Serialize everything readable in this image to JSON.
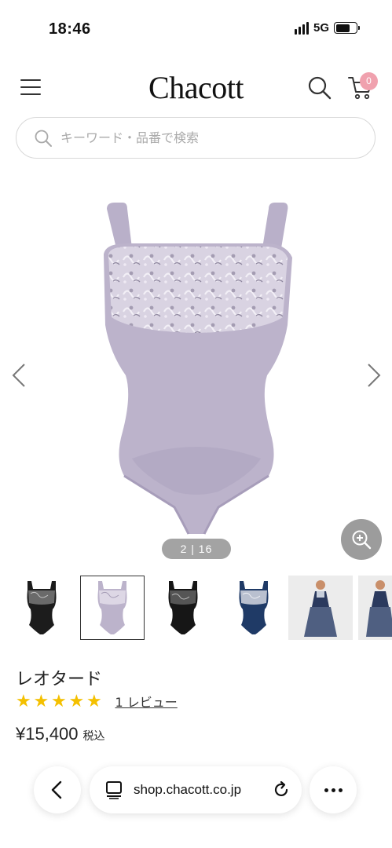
{
  "status_bar": {
    "time": "18:46",
    "network": "5G"
  },
  "header": {
    "logo": "Chacott",
    "cart_count": "0"
  },
  "search": {
    "placeholder": "キーワード・品番で検索"
  },
  "gallery": {
    "page_indicator": "2 | 16",
    "current_index": 2,
    "total": 16
  },
  "thumbnails": [
    {
      "variant": "black-lace",
      "selected": false
    },
    {
      "variant": "lavender-lace",
      "selected": true
    },
    {
      "variant": "black-lace",
      "selected": false
    },
    {
      "variant": "navy-lace",
      "selected": false
    },
    {
      "variant": "model-photo",
      "selected": false
    },
    {
      "variant": "model-photo",
      "selected": false
    }
  ],
  "product": {
    "title": "レオタード",
    "rating": 5,
    "review_link": "1 レビュー",
    "price": "¥15,400",
    "tax_label": "税込"
  },
  "browser": {
    "url": "shop.chacott.co.jp"
  },
  "colors": {
    "accent_badge": "#f0a1ae",
    "star": "#f4c000",
    "leotard_lavender": "#bcb3cb",
    "indicator_bg": "#a3a3a3"
  }
}
